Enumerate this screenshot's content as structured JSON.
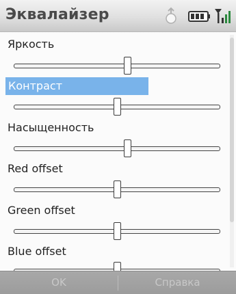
{
  "window": {
    "title": "Эквалайзер"
  },
  "status_icons": [
    "battery-icon",
    "signal-icon",
    "sync-icon"
  ],
  "accent_color": "#79b3ea",
  "settings": [
    {
      "label": "Яркость",
      "value": 0.55,
      "selected": false
    },
    {
      "label": "Контраст",
      "value": 0.5,
      "selected": true
    },
    {
      "label": "Насыщенность",
      "value": 0.55,
      "selected": false
    },
    {
      "label": "Red offset",
      "value": 0.5,
      "selected": false
    },
    {
      "label": "Green offset",
      "value": 0.5,
      "selected": false
    },
    {
      "label": "Blue offset",
      "value": 0.5,
      "selected": false
    }
  ],
  "softkeys": {
    "left": "OK",
    "right": "Справка"
  }
}
